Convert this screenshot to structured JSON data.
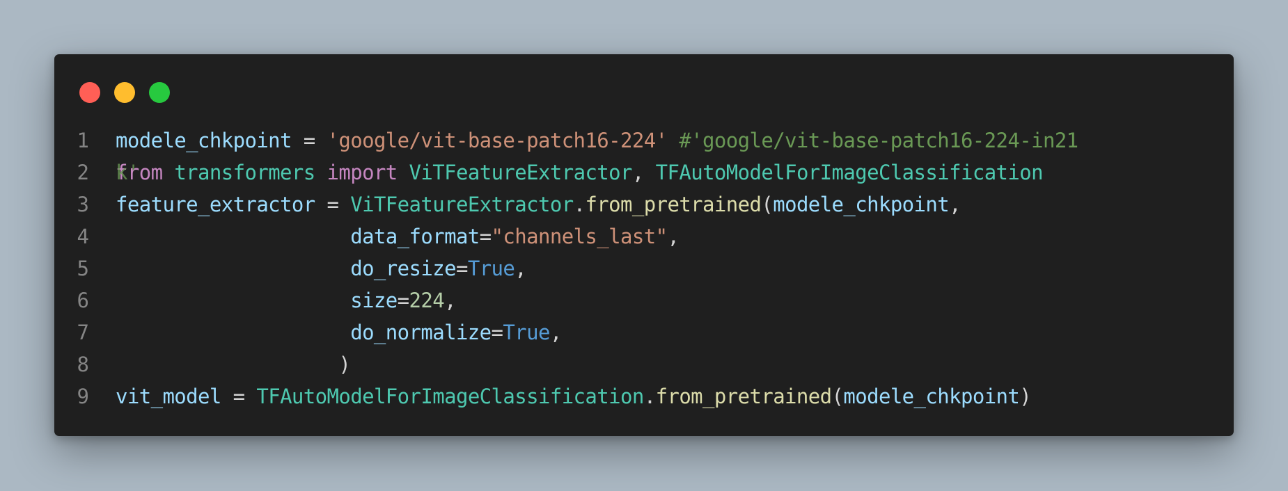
{
  "window": {
    "controls": [
      {
        "name": "close",
        "color": "#ff5f56"
      },
      {
        "name": "minimize",
        "color": "#ffbd2e"
      },
      {
        "name": "maximize",
        "color": "#27c93f"
      }
    ]
  },
  "code": {
    "lines": [
      {
        "number": "1",
        "tokens": [
          {
            "text": "modele_chkpoint",
            "kind": "var"
          },
          {
            "text": " = ",
            "kind": "op"
          },
          {
            "text": "'google/vit-base-patch16-224'",
            "kind": "str"
          },
          {
            "text": " ",
            "kind": "op"
          },
          {
            "text": "#'google/vit-base-patch16-224-in21",
            "kind": "com"
          }
        ]
      },
      {
        "number": "2",
        "overlay": "k'",
        "tokens": [
          {
            "text": "from",
            "kind": "kw"
          },
          {
            "text": " transformers ",
            "kind": "cls"
          },
          {
            "text": "import",
            "kind": "kw"
          },
          {
            "text": " ",
            "kind": "op"
          },
          {
            "text": "ViTFeatureExtractor",
            "kind": "cls"
          },
          {
            "text": ", ",
            "kind": "op"
          },
          {
            "text": "TFAutoModelForImageClassification",
            "kind": "cls"
          }
        ]
      },
      {
        "number": "3",
        "tokens": [
          {
            "text": "feature_extractor",
            "kind": "var"
          },
          {
            "text": " = ",
            "kind": "op"
          },
          {
            "text": "ViTFeatureExtractor",
            "kind": "cls"
          },
          {
            "text": ".",
            "kind": "op"
          },
          {
            "text": "from_pretrained",
            "kind": "fn"
          },
          {
            "text": "(",
            "kind": "op"
          },
          {
            "text": "modele_chkpoint",
            "kind": "var"
          },
          {
            "text": ",",
            "kind": "op"
          }
        ]
      },
      {
        "number": "4",
        "tokens": [
          {
            "text": "                    ",
            "kind": "op"
          },
          {
            "text": "data_format",
            "kind": "var"
          },
          {
            "text": "=",
            "kind": "op"
          },
          {
            "text": "\"channels_last\"",
            "kind": "str"
          },
          {
            "text": ",",
            "kind": "op"
          }
        ]
      },
      {
        "number": "5",
        "tokens": [
          {
            "text": "                    ",
            "kind": "op"
          },
          {
            "text": "do_resize",
            "kind": "var"
          },
          {
            "text": "=",
            "kind": "op"
          },
          {
            "text": "True",
            "kind": "const"
          },
          {
            "text": ",",
            "kind": "op"
          }
        ]
      },
      {
        "number": "6",
        "tokens": [
          {
            "text": "                    ",
            "kind": "op"
          },
          {
            "text": "size",
            "kind": "var"
          },
          {
            "text": "=",
            "kind": "op"
          },
          {
            "text": "224",
            "kind": "num"
          },
          {
            "text": ",",
            "kind": "op"
          }
        ]
      },
      {
        "number": "7",
        "tokens": [
          {
            "text": "                    ",
            "kind": "op"
          },
          {
            "text": "do_normalize",
            "kind": "var"
          },
          {
            "text": "=",
            "kind": "op"
          },
          {
            "text": "True",
            "kind": "const"
          },
          {
            "text": ",",
            "kind": "op"
          }
        ]
      },
      {
        "number": "8",
        "tokens": [
          {
            "text": "                   ",
            "kind": "op"
          },
          {
            "text": ")",
            "kind": "op"
          }
        ]
      },
      {
        "number": "9",
        "tokens": [
          {
            "text": "vit_model",
            "kind": "var"
          },
          {
            "text": " = ",
            "kind": "op"
          },
          {
            "text": "TFAutoModelForImageClassification",
            "kind": "cls"
          },
          {
            "text": ".",
            "kind": "op"
          },
          {
            "text": "from_pretrained",
            "kind": "fn"
          },
          {
            "text": "(",
            "kind": "op"
          },
          {
            "text": "modele_chkpoint",
            "kind": "var"
          },
          {
            "text": ")",
            "kind": "op"
          }
        ]
      }
    ]
  }
}
